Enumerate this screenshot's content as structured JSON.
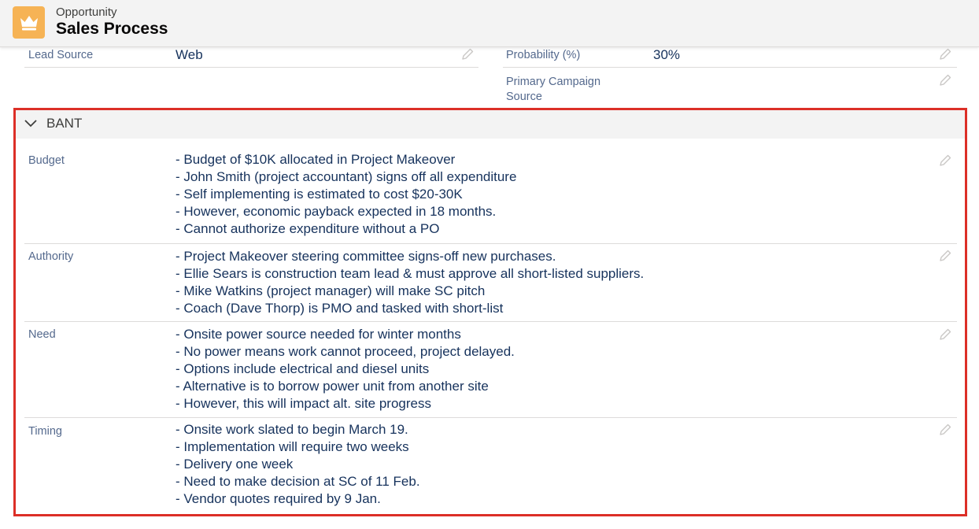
{
  "header": {
    "object_type": "Opportunity",
    "title": "Sales Process",
    "icon": "crown-icon",
    "icon_color": "#f6b355"
  },
  "fields": {
    "lead_source": {
      "label": "Lead Source",
      "value": "Web"
    },
    "probability": {
      "label": "Probability (%)",
      "value": "30%"
    },
    "primary_campaign": {
      "label_line1": "Primary Campaign",
      "label_line2": "Source",
      "value": ""
    }
  },
  "section": {
    "title": "BANT",
    "highlight_color": "#dc2f27",
    "rows": [
      {
        "label": "Budget",
        "lines": [
          "- Budget of $10K allocated in Project Makeover",
          "- John Smith (project accountant) signs off all expenditure",
          "- Self implementing is estimated to cost $20-30K",
          "- However, economic payback expected in 18 months.",
          "- Cannot authorize expenditure without a PO"
        ]
      },
      {
        "label": "Authority",
        "lines": [
          "- Project Makeover steering committee signs-off new purchases.",
          "- Ellie Sears is construction team lead & must approve all short-listed suppliers.",
          "- Mike Watkins (project manager) will make SC pitch",
          "- Coach (Dave Thorp) is PMO and tasked with short-list"
        ]
      },
      {
        "label": "Need",
        "lines": [
          "- Onsite power source needed for winter months",
          "- No power means work cannot proceed, project delayed.",
          "- Options include electrical and diesel units",
          "- Alternative is to borrow power unit from another site",
          "- However, this will impact alt. site progress"
        ]
      },
      {
        "label": "Timing",
        "lines": [
          "- Onsite work slated to begin March 19.",
          "- Implementation will require two weeks",
          "- Delivery one week",
          "- Need to make decision at SC of 11 Feb.",
          "- Vendor quotes required by 9 Jan."
        ]
      }
    ]
  }
}
